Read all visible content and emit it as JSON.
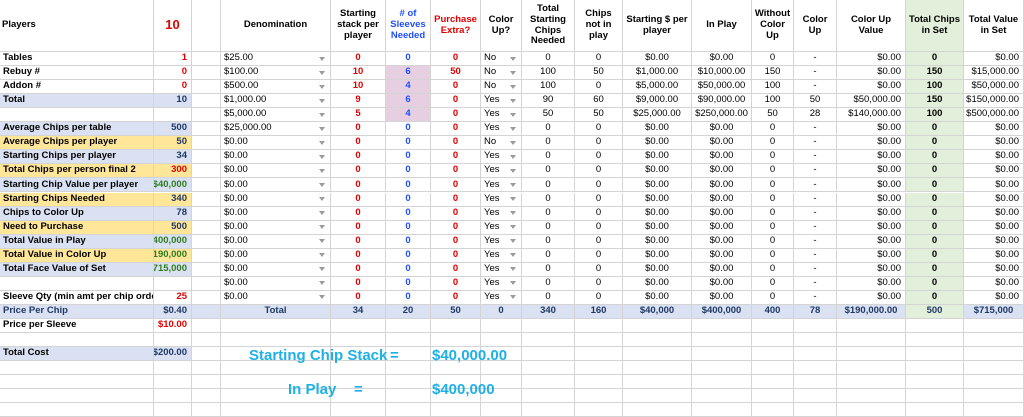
{
  "header": {
    "players_label": "Players",
    "players_value": "10",
    "denomination": "Denomination",
    "starting_stack": "Starting stack per player",
    "sleeves": "# of Sleeves Needed",
    "purchase_extra": "Purchase Extra?",
    "color_up": "Color Up?",
    "total_starting_chips": "Total Starting Chips Needed",
    "chips_not_in_play": "Chips not in play",
    "starting_dollars": "Starting $ per player",
    "in_play": "In Play",
    "without_color_up": "Without Color Up",
    "color_up_col": "Color Up",
    "color_up_value": "Color Up Value",
    "total_chips_in_set": "Total Chips in Set",
    "total_value_in_set": "Total Value in Set"
  },
  "left_panel": [
    {
      "label": "Tables",
      "value": "1"
    },
    {
      "label": "Rebuy #",
      "value": "0"
    },
    {
      "label": "Addon #",
      "value": "0"
    },
    {
      "label": "Total",
      "value": "10"
    },
    {
      "label": "",
      "value": ""
    },
    {
      "label": "Average Chips per table",
      "value": "500"
    },
    {
      "label": "Average Chips per player",
      "value": "50"
    },
    {
      "label": "Starting Chips per player",
      "value": "34"
    },
    {
      "label": "Total Chips per person final 2",
      "value": "300"
    },
    {
      "label": "Starting Chip Value per player",
      "value": "$40,000"
    },
    {
      "label": "Starting Chips Needed",
      "value": "340"
    },
    {
      "label": "Chips to Color Up",
      "value": "78"
    },
    {
      "label": "Need to Purchase",
      "value": "500"
    },
    {
      "label": "Total Value in Play",
      "value": "$400,000"
    },
    {
      "label": "Total Value in Color Up",
      "value": "$190,000"
    },
    {
      "label": "Total Face Value of Set",
      "value": "$715,000"
    },
    {
      "label": "",
      "value": ""
    },
    {
      "label": "Sleeve Qty (min amt per chip order)",
      "value": "25"
    },
    {
      "label": "Price Per Chip",
      "value": "$0.40"
    },
    {
      "label": "Price per Sleeve",
      "value": "$10.00"
    },
    {
      "label": "",
      "value": ""
    },
    {
      "label": "Total Cost",
      "value": "$200.00"
    }
  ],
  "table_rows": [
    {
      "denom": "$25.00",
      "stack": "0",
      "sleeves": "0",
      "purchase": "0",
      "colorup": "No",
      "total_start": "0",
      "not_in_play": "0",
      "start_dollar": "$0.00",
      "in_play": "$0.00",
      "without": "0",
      "cu": "-",
      "cu_value": "$0.00",
      "total_chips": "0",
      "total_value": "$0.00"
    },
    {
      "denom": "$100.00",
      "stack": "10",
      "sleeves": "6",
      "purchase": "50",
      "colorup": "No",
      "total_start": "100",
      "not_in_play": "50",
      "start_dollar": "$1,000.00",
      "in_play": "$10,000.00",
      "without": "150",
      "cu": "-",
      "cu_value": "$0.00",
      "total_chips": "150",
      "total_value": "$15,000.00"
    },
    {
      "denom": "$500.00",
      "stack": "10",
      "sleeves": "4",
      "purchase": "0",
      "colorup": "No",
      "total_start": "100",
      "not_in_play": "0",
      "start_dollar": "$5,000.00",
      "in_play": "$50,000.00",
      "without": "100",
      "cu": "-",
      "cu_value": "$0.00",
      "total_chips": "100",
      "total_value": "$50,000.00"
    },
    {
      "denom": "$1,000.00",
      "stack": "9",
      "sleeves": "6",
      "purchase": "0",
      "colorup": "Yes",
      "total_start": "90",
      "not_in_play": "60",
      "start_dollar": "$9,000.00",
      "in_play": "$90,000.00",
      "without": "100",
      "cu": "50",
      "cu_value": "$50,000.00",
      "total_chips": "150",
      "total_value": "$150,000.00"
    },
    {
      "denom": "$5,000.00",
      "stack": "5",
      "sleeves": "4",
      "purchase": "0",
      "colorup": "Yes",
      "total_start": "50",
      "not_in_play": "50",
      "start_dollar": "$25,000.00",
      "in_play": "$250,000.00",
      "without": "50",
      "cu": "28",
      "cu_value": "$140,000.00",
      "total_chips": "100",
      "total_value": "$500,000.00"
    },
    {
      "denom": "$25,000.00",
      "stack": "0",
      "sleeves": "0",
      "purchase": "0",
      "colorup": "Yes",
      "total_start": "0",
      "not_in_play": "0",
      "start_dollar": "$0.00",
      "in_play": "$0.00",
      "without": "0",
      "cu": "-",
      "cu_value": "$0.00",
      "total_chips": "0",
      "total_value": "$0.00"
    },
    {
      "denom": "$0.00",
      "stack": "0",
      "sleeves": "0",
      "purchase": "0",
      "colorup": "No",
      "total_start": "0",
      "not_in_play": "0",
      "start_dollar": "$0.00",
      "in_play": "$0.00",
      "without": "0",
      "cu": "-",
      "cu_value": "$0.00",
      "total_chips": "0",
      "total_value": "$0.00"
    },
    {
      "denom": "$0.00",
      "stack": "0",
      "sleeves": "0",
      "purchase": "0",
      "colorup": "Yes",
      "total_start": "0",
      "not_in_play": "0",
      "start_dollar": "$0.00",
      "in_play": "$0.00",
      "without": "0",
      "cu": "-",
      "cu_value": "$0.00",
      "total_chips": "0",
      "total_value": "$0.00"
    },
    {
      "denom": "$0.00",
      "stack": "0",
      "sleeves": "0",
      "purchase": "0",
      "colorup": "Yes",
      "total_start": "0",
      "not_in_play": "0",
      "start_dollar": "$0.00",
      "in_play": "$0.00",
      "without": "0",
      "cu": "-",
      "cu_value": "$0.00",
      "total_chips": "0",
      "total_value": "$0.00"
    },
    {
      "denom": "$0.00",
      "stack": "0",
      "sleeves": "0",
      "purchase": "0",
      "colorup": "Yes",
      "total_start": "0",
      "not_in_play": "0",
      "start_dollar": "$0.00",
      "in_play": "$0.00",
      "without": "0",
      "cu": "-",
      "cu_value": "$0.00",
      "total_chips": "0",
      "total_value": "$0.00"
    },
    {
      "denom": "$0.00",
      "stack": "0",
      "sleeves": "0",
      "purchase": "0",
      "colorup": "Yes",
      "total_start": "0",
      "not_in_play": "0",
      "start_dollar": "$0.00",
      "in_play": "$0.00",
      "without": "0",
      "cu": "-",
      "cu_value": "$0.00",
      "total_chips": "0",
      "total_value": "$0.00"
    },
    {
      "denom": "$0.00",
      "stack": "0",
      "sleeves": "0",
      "purchase": "0",
      "colorup": "Yes",
      "total_start": "0",
      "not_in_play": "0",
      "start_dollar": "$0.00",
      "in_play": "$0.00",
      "without": "0",
      "cu": "-",
      "cu_value": "$0.00",
      "total_chips": "0",
      "total_value": "$0.00"
    },
    {
      "denom": "$0.00",
      "stack": "0",
      "sleeves": "0",
      "purchase": "0",
      "colorup": "Yes",
      "total_start": "0",
      "not_in_play": "0",
      "start_dollar": "$0.00",
      "in_play": "$0.00",
      "without": "0",
      "cu": "-",
      "cu_value": "$0.00",
      "total_chips": "0",
      "total_value": "$0.00"
    },
    {
      "denom": "$0.00",
      "stack": "0",
      "sleeves": "0",
      "purchase": "0",
      "colorup": "Yes",
      "total_start": "0",
      "not_in_play": "0",
      "start_dollar": "$0.00",
      "in_play": "$0.00",
      "without": "0",
      "cu": "-",
      "cu_value": "$0.00",
      "total_chips": "0",
      "total_value": "$0.00"
    },
    {
      "denom": "$0.00",
      "stack": "0",
      "sleeves": "0",
      "purchase": "0",
      "colorup": "Yes",
      "total_start": "0",
      "not_in_play": "0",
      "start_dollar": "$0.00",
      "in_play": "$0.00",
      "without": "0",
      "cu": "-",
      "cu_value": "$0.00",
      "total_chips": "0",
      "total_value": "$0.00"
    },
    {
      "denom": "$0.00",
      "stack": "0",
      "sleeves": "0",
      "purchase": "0",
      "colorup": "Yes",
      "total_start": "0",
      "not_in_play": "0",
      "start_dollar": "$0.00",
      "in_play": "$0.00",
      "without": "0",
      "cu": "-",
      "cu_value": "$0.00",
      "total_chips": "0",
      "total_value": "$0.00"
    },
    {
      "denom": "$0.00",
      "stack": "0",
      "sleeves": "0",
      "purchase": "0",
      "colorup": "Yes",
      "total_start": "0",
      "not_in_play": "0",
      "start_dollar": "$0.00",
      "in_play": "$0.00",
      "without": "0",
      "cu": "-",
      "cu_value": "$0.00",
      "total_chips": "0",
      "total_value": "$0.00"
    },
    {
      "denom": "$0.00",
      "stack": "0",
      "sleeves": "0",
      "purchase": "0",
      "colorup": "Yes",
      "total_start": "0",
      "not_in_play": "0",
      "start_dollar": "$0.00",
      "in_play": "$0.00",
      "without": "0",
      "cu": "-",
      "cu_value": "$0.00",
      "total_chips": "0",
      "total_value": "$0.00"
    }
  ],
  "totals": {
    "label": "Total",
    "stack": "34",
    "sleeves": "20",
    "purchase": "50",
    "colorup": "0",
    "total_start": "340",
    "not_in_play": "160",
    "start_dollar": "$40,000",
    "in_play": "$400,000",
    "without": "400",
    "cu": "78",
    "cu_value": "$190,000.00",
    "total_chips": "500",
    "total_value": "$715,000"
  },
  "summary": {
    "starting_label": "Starting Chip Stack",
    "starting_eq": "=",
    "starting_value": "$40,000.00",
    "inplay_label": "In Play",
    "inplay_eq": "=",
    "inplay_value": "$400,000"
  },
  "colors": {
    "label_blue_bg": "#d9e1f2",
    "label_gold_bg": "#ffe699",
    "sleeve_pink_bg": "#e6cfe0",
    "chips_green_bg": "#e2efda",
    "summary_cyan": "#1fb0e6"
  },
  "icons": {
    "dropdown": "dropdown-arrow-icon"
  }
}
